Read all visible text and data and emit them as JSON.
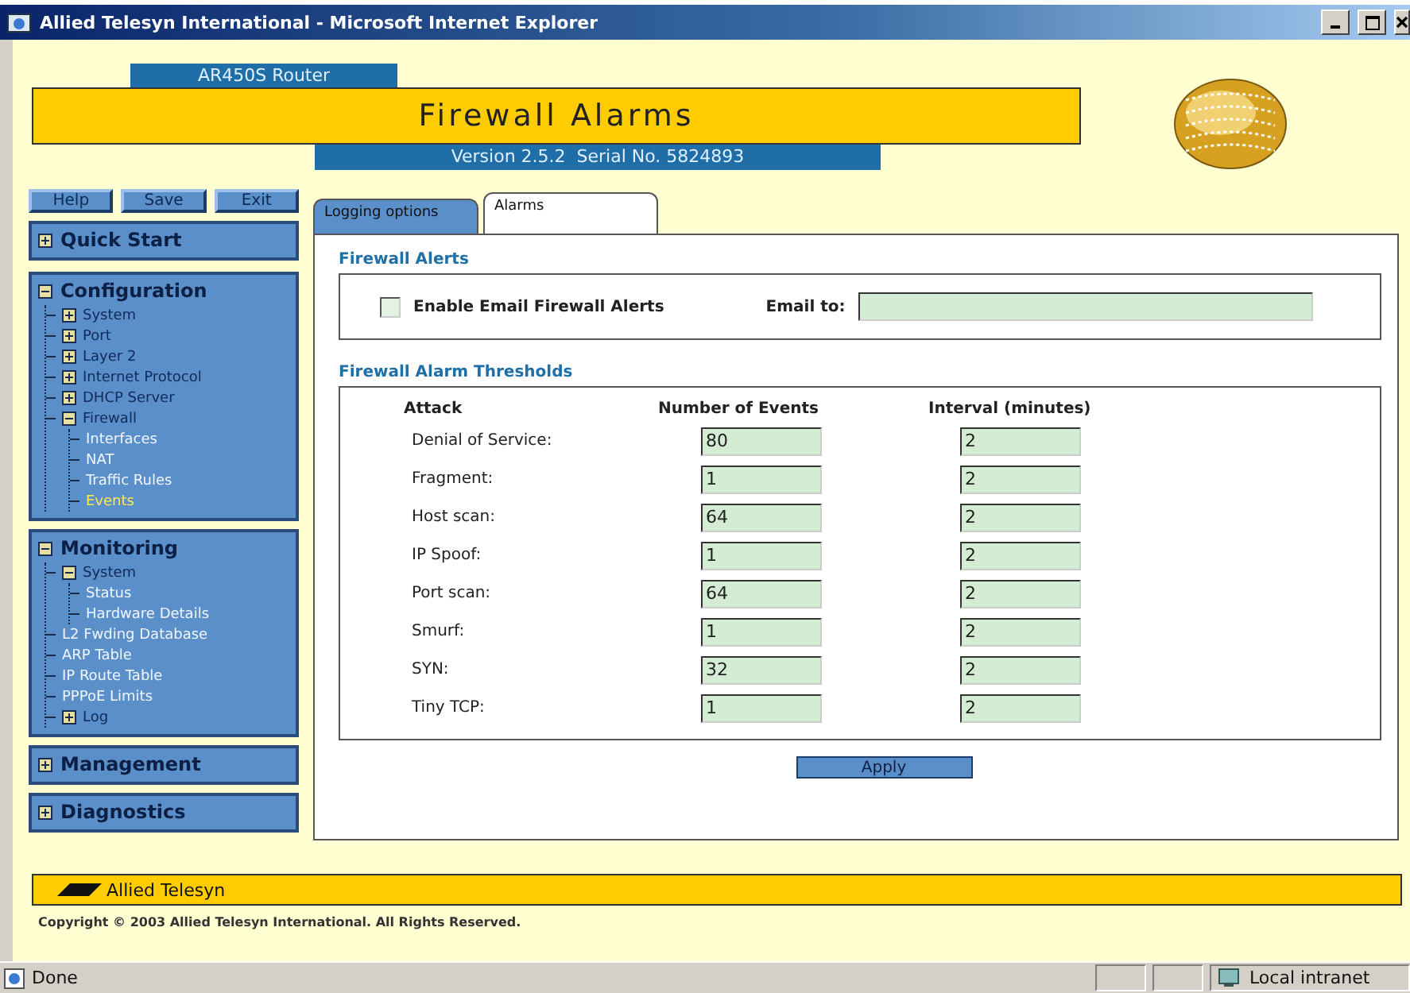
{
  "window": {
    "title": "Allied Telesyn International - Microsoft Internet Explorer"
  },
  "header": {
    "product": "AR450S Router",
    "page_title": "Firewall Alarms",
    "version": "Version 2.5.2  Serial No. 5824893"
  },
  "sidebar": {
    "buttons": [
      "Help",
      "Save",
      "Exit"
    ],
    "sections": [
      {
        "label": "Quick Start",
        "expanded": false
      },
      {
        "label": "Configuration",
        "expanded": true,
        "items": [
          {
            "label": "System",
            "kind": "folder",
            "expanded": false
          },
          {
            "label": "Port",
            "kind": "folder",
            "expanded": false
          },
          {
            "label": "Layer 2",
            "kind": "folder",
            "expanded": false
          },
          {
            "label": "Internet Protocol",
            "kind": "folder",
            "expanded": false
          },
          {
            "label": "DHCP Server",
            "kind": "folder",
            "expanded": false
          },
          {
            "label": "Firewall",
            "kind": "folder",
            "expanded": true,
            "children": [
              {
                "label": "Interfaces",
                "kind": "page",
                "selected": false
              },
              {
                "label": "NAT",
                "kind": "page",
                "selected": false
              },
              {
                "label": "Traffic Rules",
                "kind": "page",
                "selected": false
              },
              {
                "label": "Events",
                "kind": "page",
                "selected": true
              }
            ]
          }
        ]
      },
      {
        "label": "Monitoring",
        "expanded": true,
        "items": [
          {
            "label": "System",
            "kind": "folder",
            "expanded": true,
            "children": [
              {
                "label": "Status",
                "kind": "page",
                "selected": false
              },
              {
                "label": "Hardware Details",
                "kind": "page",
                "selected": false
              }
            ]
          },
          {
            "label": "L2 Fwding Database",
            "kind": "page",
            "selected": false
          },
          {
            "label": "ARP Table",
            "kind": "page",
            "selected": false
          },
          {
            "label": "IP Route Table",
            "kind": "page",
            "selected": false
          },
          {
            "label": "PPPoE Limits",
            "kind": "page",
            "selected": false
          },
          {
            "label": "Log",
            "kind": "folder",
            "expanded": false
          }
        ]
      },
      {
        "label": "Management",
        "expanded": false
      },
      {
        "label": "Diagnostics",
        "expanded": false
      }
    ]
  },
  "tabs": [
    {
      "label": "Logging options",
      "selected": false
    },
    {
      "label": "Alarms",
      "selected": true
    }
  ],
  "alerts": {
    "heading": "Firewall Alerts",
    "checkbox_label": "Enable Email Firewall Alerts",
    "checked": false,
    "email_label": "Email to:"
  },
  "thresholds": {
    "heading": "Firewall Alarm Thresholds",
    "columns": [
      "Attack",
      "Number of Events",
      "Interval (minutes)"
    ],
    "rows": [
      {
        "attack": "Denial of Service:",
        "events": "80",
        "interval": "2"
      },
      {
        "attack": "Fragment:",
        "events": "1",
        "interval": "2"
      },
      {
        "attack": "Host scan:",
        "events": "64",
        "interval": "2"
      },
      {
        "attack": "IP Spoof:",
        "events": "1",
        "interval": "2"
      },
      {
        "attack": "Port scan:",
        "events": "64",
        "interval": "2"
      },
      {
        "attack": "Smurf:",
        "events": "1",
        "interval": "2"
      },
      {
        "attack": "SYN:",
        "events": "32",
        "interval": "2"
      },
      {
        "attack": "Tiny TCP:",
        "events": "1",
        "interval": "2"
      }
    ]
  },
  "apply_button": "Apply",
  "footer": {
    "brand": "Allied Telesyn",
    "copyright": "Copyright © 2003 Allied Telesyn International. All Rights Reserved."
  },
  "status_bar": {
    "status": "Done",
    "zone": "Local intranet"
  }
}
